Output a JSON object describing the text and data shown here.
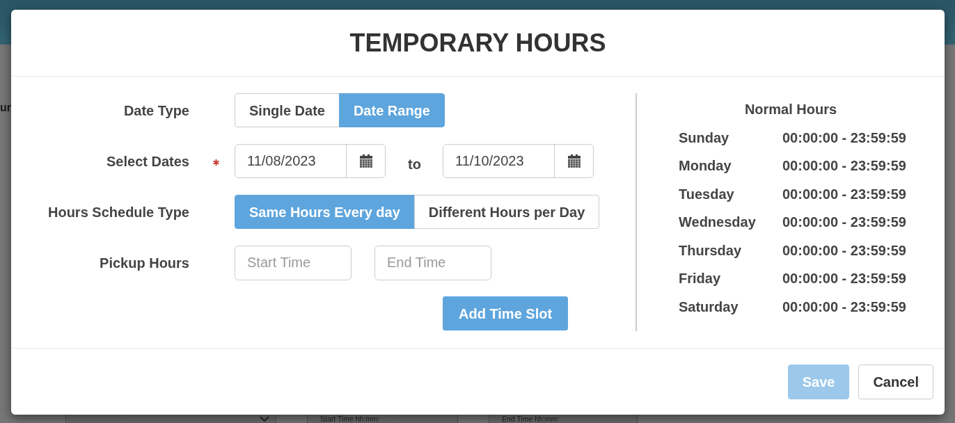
{
  "page": {
    "text_fragment": "ur",
    "fields": [
      {
        "kind": "select"
      },
      {
        "kind": "input",
        "placeholder": "Start Time hh:mm:"
      },
      {
        "kind": "input",
        "placeholder": "End Time hh:mm:"
      }
    ]
  },
  "dialog": {
    "title": "TEMPORARY HOURS",
    "form": [
      {
        "kind": "toggle",
        "label": "Date Type",
        "required": false,
        "options": [
          {
            "label": "Single Date",
            "selected": false
          },
          {
            "label": "Date Range",
            "selected": true
          }
        ]
      },
      {
        "kind": "date_range",
        "label": "Select Dates",
        "required": true,
        "start": "11/08/2023",
        "separator": "to",
        "end": "11/10/2023"
      },
      {
        "kind": "toggle",
        "label": "Hours Schedule Type",
        "required": false,
        "options": [
          {
            "label": "Same Hours Every day",
            "selected": true
          },
          {
            "label": "Different Hours per Day",
            "selected": false
          }
        ]
      },
      {
        "kind": "time_range",
        "label": "Pickup Hours",
        "required": false,
        "start_placeholder": "Start Time",
        "end_placeholder": "End Time"
      },
      {
        "kind": "action",
        "button": "Add Time Slot"
      }
    ],
    "normal_hours": {
      "title": "Normal Hours",
      "days": [
        {
          "day": "Sunday",
          "hours": "00:00:00 - 23:59:59"
        },
        {
          "day": "Monday",
          "hours": "00:00:00 - 23:59:59"
        },
        {
          "day": "Tuesday",
          "hours": "00:00:00 - 23:59:59"
        },
        {
          "day": "Wednesday",
          "hours": "00:00:00 - 23:59:59"
        },
        {
          "day": "Thursday",
          "hours": "00:00:00 - 23:59:59"
        },
        {
          "day": "Friday",
          "hours": "00:00:00 - 23:59:59"
        },
        {
          "day": "Saturday",
          "hours": "00:00:00 - 23:59:59"
        }
      ]
    },
    "buttons": [
      {
        "kind": "primary",
        "label": "Save",
        "disabled": true
      },
      {
        "kind": "secondary",
        "label": "Cancel",
        "disabled": false
      }
    ]
  }
}
